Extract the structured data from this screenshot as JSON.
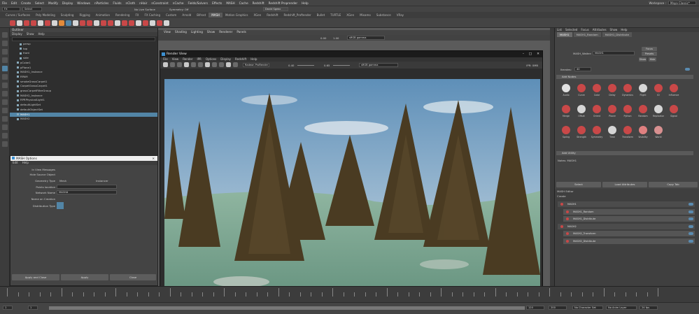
{
  "menubar": [
    "File",
    "Edit",
    "Create",
    "Select",
    "Modify",
    "Display",
    "Windows",
    "nParticles",
    "Fluids",
    "nCloth",
    "nHair",
    "nConstraint",
    "nCache",
    "Fields/Solvers",
    "Effects",
    "MASH",
    "Cache",
    "Redshift",
    "Redshift Proprender",
    "Help"
  ],
  "workspace": {
    "label": "Workspace :",
    "value": "Maya Classic*"
  },
  "status": {
    "mode": "FX",
    "select": "Select",
    "live": "No Live Surface",
    "symmetry": "Symmetry: Off",
    "user": "David Sgeac"
  },
  "shelf_tabs": [
    "Curves / Surfaces",
    "Poly Modeling",
    "Sculpting",
    "Rigging",
    "Animation",
    "Rendering",
    "FX",
    "FX Caching",
    "Custom",
    "Arnold",
    "Bifrost",
    "MASH",
    "Motion Graphics",
    "XGen",
    "Redshift",
    "Redshift_Proftender",
    "Bullet",
    "TURTLE",
    "XGen",
    "Mixamo",
    "Substance",
    "VRay"
  ],
  "shelf_active": "MASH",
  "outliner": {
    "title": "Outliner",
    "menu": [
      "Display",
      "Show",
      "Help"
    ],
    "items": [
      "persp",
      "top",
      "front",
      "side",
      "pCube1",
      "pPlane1",
      "MASH1_Instance",
      "RPAM",
      "smokeGrassCarpet1",
      "CarpetGrassCarpet1",
      "grassCarpetFilterGroup",
      "MASH2_Instance",
      "RPRPhysicalLight1",
      "defaultLightSet",
      "defaultObjectSet",
      "MASH1",
      "MASH2"
    ],
    "selected": "MASH1"
  },
  "viewport_menu": [
    "View",
    "Shading",
    "Lighting",
    "Show",
    "Renderer",
    "Panels"
  ],
  "viewport_tool": {
    "v1": "0.00",
    "v2": "1.00",
    "cs": "sRGB gamma"
  },
  "render_view": {
    "title": "Render View",
    "menu": [
      "File",
      "View",
      "Render",
      "IPR",
      "Options",
      "Display",
      "Redshift",
      "Help"
    ],
    "renderer": "Radeon ProRender",
    "exposure": "0.40",
    "gamma": "0.65",
    "colorspace": "sRGB gamma",
    "ipr": "IPR: 0MB",
    "info1": "size: 1920 x 1080  zoom: 0.613",
    "info2": "Frame: 0  Render Time: 0:00:36  Passes: 3000"
  },
  "mash_options": {
    "title": "MASH Options",
    "menu": [
      "Edit",
      "Help"
    ],
    "labels": [
      "In View Messages",
      "Hide Source Object",
      "Geometry Type",
      "Points location",
      "Network Name",
      "Name on Creation",
      "Distribution Type"
    ],
    "geometry_choices": [
      "Mesh",
      "Instancer"
    ],
    "network_name": "MASH#",
    "buttons": [
      "Apply and Close",
      "Apply",
      "Close"
    ]
  },
  "attr_editor": {
    "tabs": [
      "List",
      "Selected",
      "Focus",
      "Attributes",
      "Show",
      "Help"
    ],
    "node_tabs": [
      "MASH1",
      "MASH1_Random",
      "MASH1_Distribute"
    ],
    "name_label": "MASH_Waiter:",
    "name_value": "MASH1",
    "focus_btns": [
      "Focus",
      "Presets",
      "Show",
      "Hide"
    ],
    "iter_label": "Iterates:",
    "iter_value": "40",
    "section_nodes": "Add Nodes",
    "nodes": [
      "Audio",
      "Curve",
      "Color",
      "Delay",
      "Dynamics",
      "Flight",
      "ID",
      "Influence",
      "Merge",
      "Offset",
      "Orient",
      "Placer",
      "Python",
      "Random",
      "Replicator",
      "Signal",
      "Spring",
      "Strength",
      "Symmetry",
      "Time",
      "Transform",
      "Visibility",
      "World"
    ],
    "section_utility": "Add Utility",
    "notes_label": "Notes: MASH1",
    "bottom_btns": [
      "Select",
      "Load Attributes",
      "Copy Tab"
    ]
  },
  "mash_editor": {
    "title": "MASH Editor",
    "menu": "Create",
    "rows": [
      {
        "label": "MASH1",
        "sub": false
      },
      {
        "label": "MASH1_Random",
        "sub": true
      },
      {
        "label": "MASH1_Distribute",
        "sub": true
      },
      {
        "label": "MASH2",
        "sub": false
      },
      {
        "label": "MASH2_Transform",
        "sub": true
      },
      {
        "label": "MASH2_Distribute",
        "sub": true
      }
    ]
  },
  "range": {
    "start": "1",
    "end": "120",
    "s2": "120",
    "e2": "200",
    "charset": "No Character Set",
    "anim": "No Anim Layer",
    "fps": "24 fps"
  },
  "colors": {
    "accent": "#5285a6",
    "active_blue": "#5a8bb0",
    "red": "#c94848"
  }
}
